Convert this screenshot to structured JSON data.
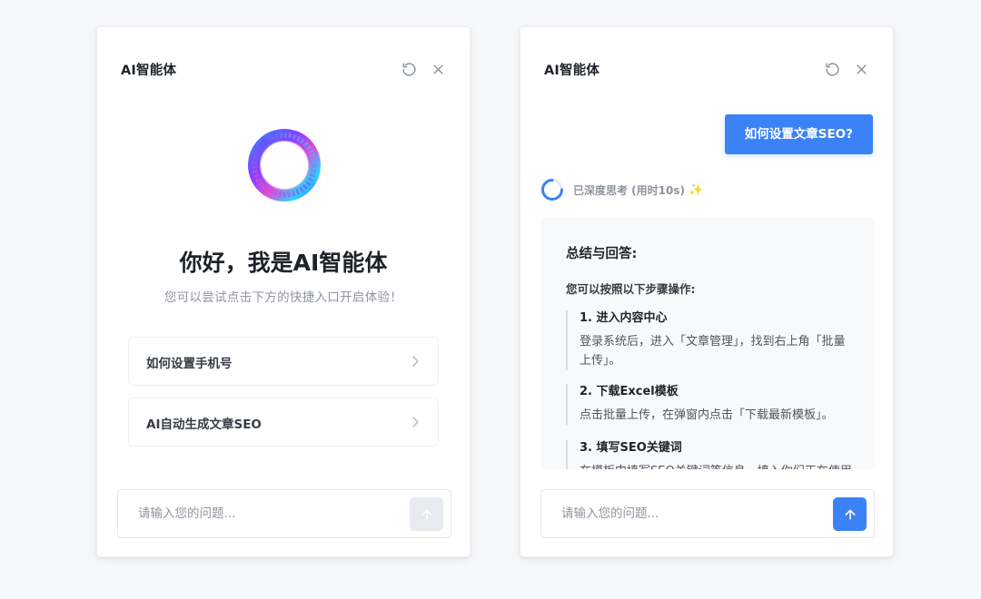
{
  "left_panel": {
    "title": "AI智能体",
    "greeting": "你好，我是AI智能体",
    "subtitle": "您可以尝试点击下方的快捷入口开启体验！",
    "quick_entries": [
      {
        "label": "如何设置手机号"
      },
      {
        "label": "AI自动生成文章SEO"
      }
    ],
    "input": {
      "placeholder": "请输入您的问题...",
      "value": ""
    },
    "send_state": "disabled"
  },
  "right_panel": {
    "title": "AI智能体",
    "user_message": "如何设置文章SEO?",
    "thinking_status": "已深度思考 (用时10s)",
    "answer": {
      "title": "总结与回答:",
      "intro": "您可以按照以下步骤操作:",
      "steps": [
        {
          "title": "1. 进入内容中心",
          "desc": "登录系统后，进入「文章管理」，找到右上角「批量上传」。"
        },
        {
          "title": "2. 下载Excel模板",
          "desc": "点击批量上传，在弹窗内点击「下载最新模板」。"
        },
        {
          "title": "3. 填写SEO关键词",
          "desc": "在模板中填写SEO关键词等信息，填入你们正在使用的内容。"
        }
      ]
    },
    "input": {
      "placeholder": "请输入您的问题...",
      "value": ""
    },
    "send_state": "active"
  },
  "icons": {
    "refresh": "refresh-icon",
    "close": "close-icon",
    "chevron": "chevron-right-icon",
    "send": "arrow-up-icon",
    "spinner": "loading-spinner-icon",
    "sparkle": "sparkle-icon"
  },
  "colors": {
    "accent": "#3b82f6",
    "send_disabled": "#e7eaef",
    "text_primary": "#1f2329",
    "text_secondary": "#8f959e"
  }
}
